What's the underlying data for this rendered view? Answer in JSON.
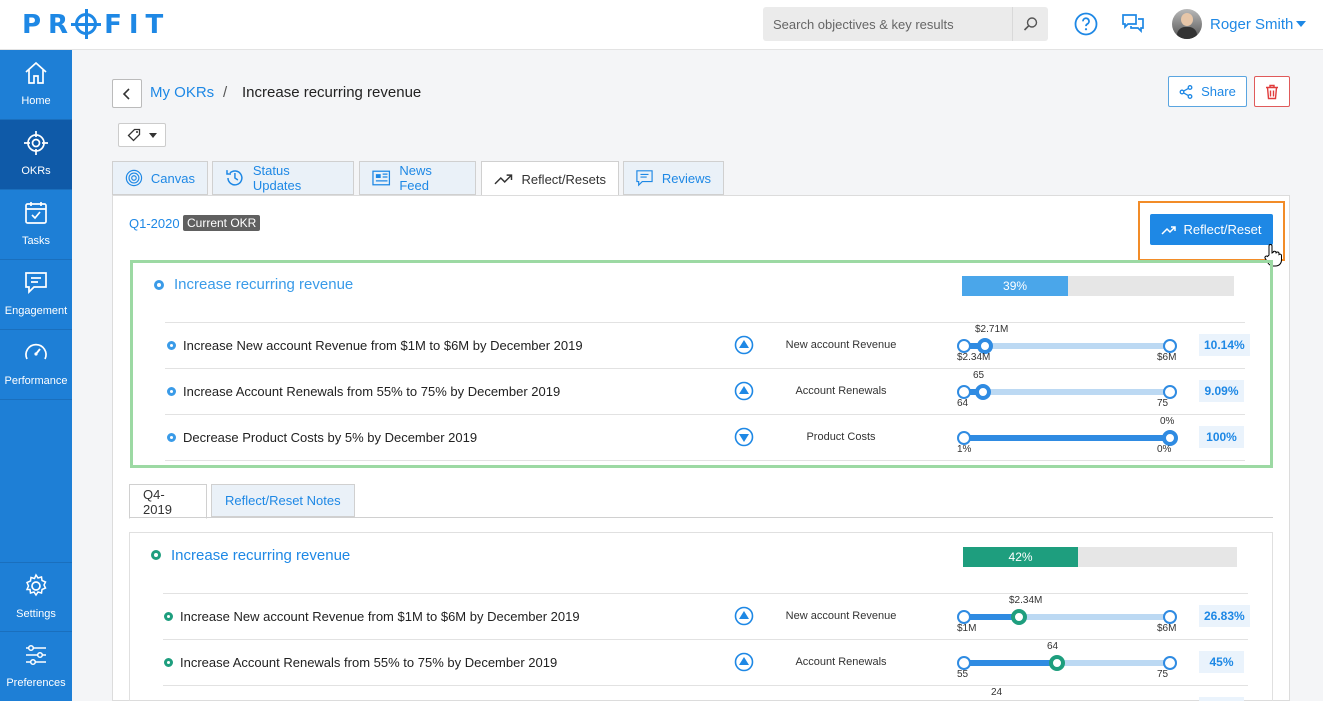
{
  "brand": {
    "logo_text_left": "PR",
    "logo_text_right": "FIT"
  },
  "header": {
    "search_placeholder": "Search objectives & key results",
    "user_name": "Roger Smith"
  },
  "sidebar": {
    "items": [
      {
        "label": "Home",
        "icon": "home-icon"
      },
      {
        "label": "OKRs",
        "icon": "target-icon",
        "active": true
      },
      {
        "label": "Tasks",
        "icon": "tasks-icon"
      },
      {
        "label": "Engagement",
        "icon": "chat-icon"
      },
      {
        "label": "Performance",
        "icon": "gauge-icon"
      },
      {
        "label": "Settings",
        "icon": "gear-icon"
      },
      {
        "label": "Preferences",
        "icon": "sliders-icon"
      }
    ]
  },
  "breadcrumb": {
    "parent": "My OKRs",
    "separator": "/",
    "current": "Increase recurring revenue"
  },
  "actions": {
    "share": "Share"
  },
  "tabs": [
    {
      "label": "Canvas",
      "icon": "canvas-icon"
    },
    {
      "label": "Status Updates",
      "icon": "history-icon"
    },
    {
      "label": "News Feed",
      "icon": "newspaper-icon"
    },
    {
      "label": "Reflect/Resets",
      "icon": "trend-icon",
      "active": true
    },
    {
      "label": "Reviews",
      "icon": "review-icon"
    }
  ],
  "current": {
    "quarter": "Q1-2020",
    "badge": "Current OKR",
    "reflect_button": "Reflect/Reset",
    "objective": {
      "title": "Increase recurring revenue",
      "progress_label": "39%",
      "progress": 0.39
    },
    "key_results": [
      {
        "title": "Increase New account Revenue from $1M to $6M by December 2019",
        "direction": "up",
        "metric": "New account Revenue",
        "start": "$2.34M",
        "current": "$2.71M",
        "target": "$6M",
        "pct": "10.14%",
        "fraction": 0.1014
      },
      {
        "title": "Increase Account Renewals from 55% to 75% by December 2019",
        "direction": "up",
        "metric": "Account Renewals",
        "start": "64",
        "current": "65",
        "target": "75",
        "pct": "9.09%",
        "fraction": 0.0909
      },
      {
        "title": "Decrease Product Costs by 5% by December 2019",
        "direction": "down",
        "metric": "Product Costs",
        "start": "1%",
        "current": "0%",
        "target": "0%",
        "pct": "100%",
        "fraction": 1.0
      }
    ]
  },
  "subtabs": [
    {
      "label": "Q4-2019",
      "active": true
    },
    {
      "label": "Reflect/Reset Notes"
    }
  ],
  "previous": {
    "objective": {
      "title": "Increase recurring revenue",
      "progress_label": "42%",
      "progress": 0.42
    },
    "key_results": [
      {
        "title": "Increase New account Revenue from $1M to $6M by December 2019",
        "direction": "up",
        "metric": "New account Revenue",
        "start": "$1M",
        "current": "$2.34M",
        "target": "$6M",
        "pct": "26.83%",
        "fraction": 0.2683
      },
      {
        "title": "Increase Account Renewals from 55% to 75% by December 2019",
        "direction": "up",
        "metric": "Account Renewals",
        "start": "55",
        "current": "64",
        "target": "75",
        "pct": "45%",
        "fraction": 0.45
      },
      {
        "current": "24"
      }
    ]
  },
  "colors": {
    "primary": "#1e88e5",
    "sidebar": "#1e7fd6",
    "highlight": "#f28c28",
    "current_box": "#9cd9a3",
    "prev_progress": "#1e9e7e"
  }
}
